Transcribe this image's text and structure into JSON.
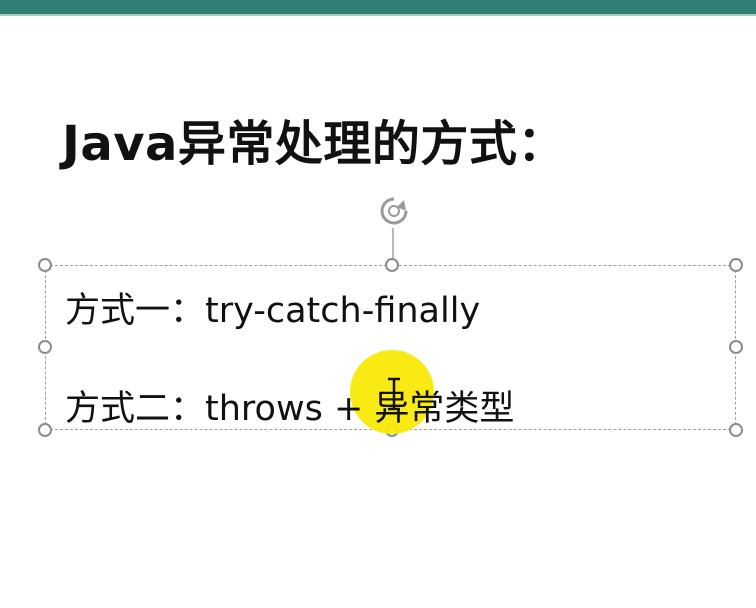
{
  "slide": {
    "title": "Java异常处理的方式：",
    "lines": [
      {
        "label": "方式一：",
        "text": "try-catch-finally"
      },
      {
        "label": "方式二：",
        "text": "throws + 异常类型"
      }
    ]
  },
  "icons": {
    "rotate": "rotate-icon",
    "text_cursor": "text-cursor-icon"
  },
  "colors": {
    "top_bar": "#2f7f76",
    "cursor_highlight": "#f8e800",
    "text": "#111111",
    "selection_border": "#a0a0a0"
  }
}
